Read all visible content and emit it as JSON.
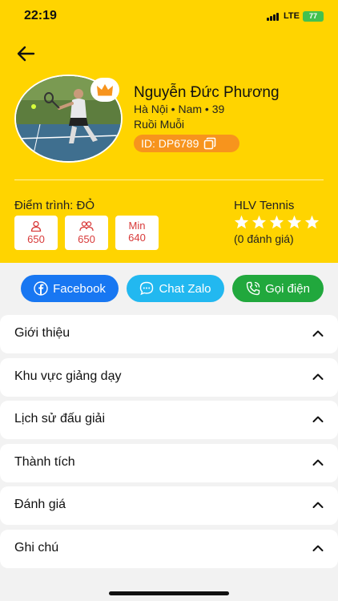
{
  "status_bar": {
    "time": "22:19",
    "network": "LTE",
    "battery": "77"
  },
  "profile": {
    "name": "Nguyễn Đức Phương",
    "info_line": "Hà Nội • Nam • 39",
    "nickname": "Ruồi Muỗi",
    "id_label": "ID: DP6789"
  },
  "level": {
    "label": "Điểm trình: ĐỎ"
  },
  "stats": [
    {
      "icon": "person-icon",
      "value": "650"
    },
    {
      "icon": "group-icon",
      "value": "650"
    },
    {
      "icon": "text",
      "label": "Min",
      "value": "640"
    }
  ],
  "coach": {
    "title": "HLV Tennis",
    "rating": 0,
    "max_rating": 5,
    "reviews": "(0 đánh giá)"
  },
  "actions": [
    {
      "label": "Facebook",
      "icon": "facebook-icon",
      "color": "#1877F2"
    },
    {
      "label": "Chat Zalo",
      "icon": "chat-icon",
      "color": "#22B8F0"
    },
    {
      "label": "Gọi điện",
      "icon": "phone-icon",
      "color": "#21A83D"
    }
  ],
  "sections": [
    {
      "label": "Giới thiệu"
    },
    {
      "label": "Khu vực giảng dạy"
    },
    {
      "label": "Lịch sử đấu giải"
    },
    {
      "label": "Thành tích"
    },
    {
      "label": "Đánh giá"
    },
    {
      "label": "Ghi chú"
    }
  ],
  "colors": {
    "header": "#FFD400",
    "accent_orange": "#F7941D",
    "stat_red": "#D83A3A",
    "star_empty": "#FFFFFF"
  }
}
